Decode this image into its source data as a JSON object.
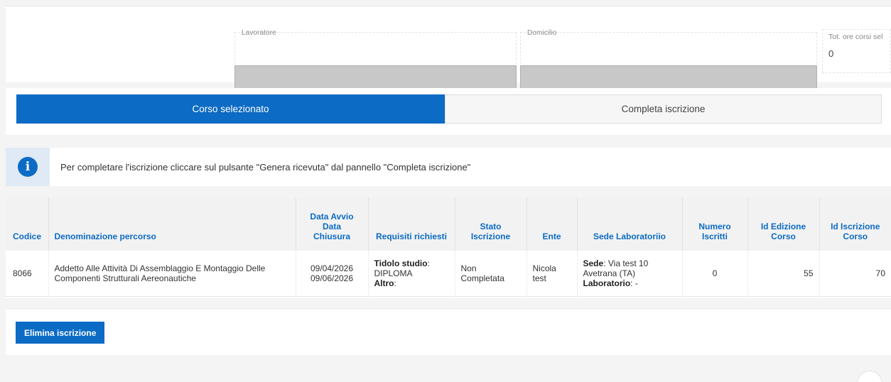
{
  "header": {
    "lavoratore_label": "Lavoratore",
    "domicilio_label": "Domicilio",
    "tot_ore_label": "Tot. ore corsi sel",
    "tot_ore_value": "0"
  },
  "tabs": [
    {
      "label": "Corso selezionato",
      "active": true
    },
    {
      "label": "Completa iscrizione",
      "active": false
    }
  ],
  "info": {
    "icon": "info-icon",
    "glyph": "i",
    "message": "Per completare l'iscrizione cliccare sul pulsante \"Genera ricevuta\" dal pannello \"Completa iscrizione\""
  },
  "table": {
    "headers": {
      "codice": "Codice",
      "denominazione": "Denominazione percorso",
      "data_avvio": "Data Avvio",
      "data_sep": "Data",
      "chiusura": "Chiusura",
      "requisiti": "Requisiti richiesti",
      "stato": "Stato Iscrizione",
      "ente": "Ente",
      "sede": "Sede Laboratoriio",
      "numero": "Numero Iscritti",
      "id_edizione": "Id Edizione Corso",
      "id_iscrizione": "Id Iscrizione Corso"
    },
    "row": {
      "codice": "8066",
      "denominazione": "Addetto Alle Attività Di Assemblaggio E Montaggio Delle Componenti Strutturali Aereonautiche",
      "data_avvio": "09/04/2026",
      "data_chiusura": "09/06/2026",
      "req_titolo_label": "Tidolo studio",
      "req_titolo_value": "DIPLOMA",
      "req_altro_label": "Altro",
      "stato": "Non Completata",
      "ente": "Nicola test",
      "sede_label": "Sede",
      "sede_value": "Via test 10 Avetrana (TA)",
      "lab_label": "Laboratorio",
      "lab_value": "-",
      "numero_iscritti": "0",
      "id_edizione": "55",
      "id_iscrizione": "70"
    }
  },
  "actions": {
    "elimina_label": "Elimina iscrizione"
  },
  "colors": {
    "primary": "#0c6bc5",
    "info_bg": "#dfeaf6"
  }
}
